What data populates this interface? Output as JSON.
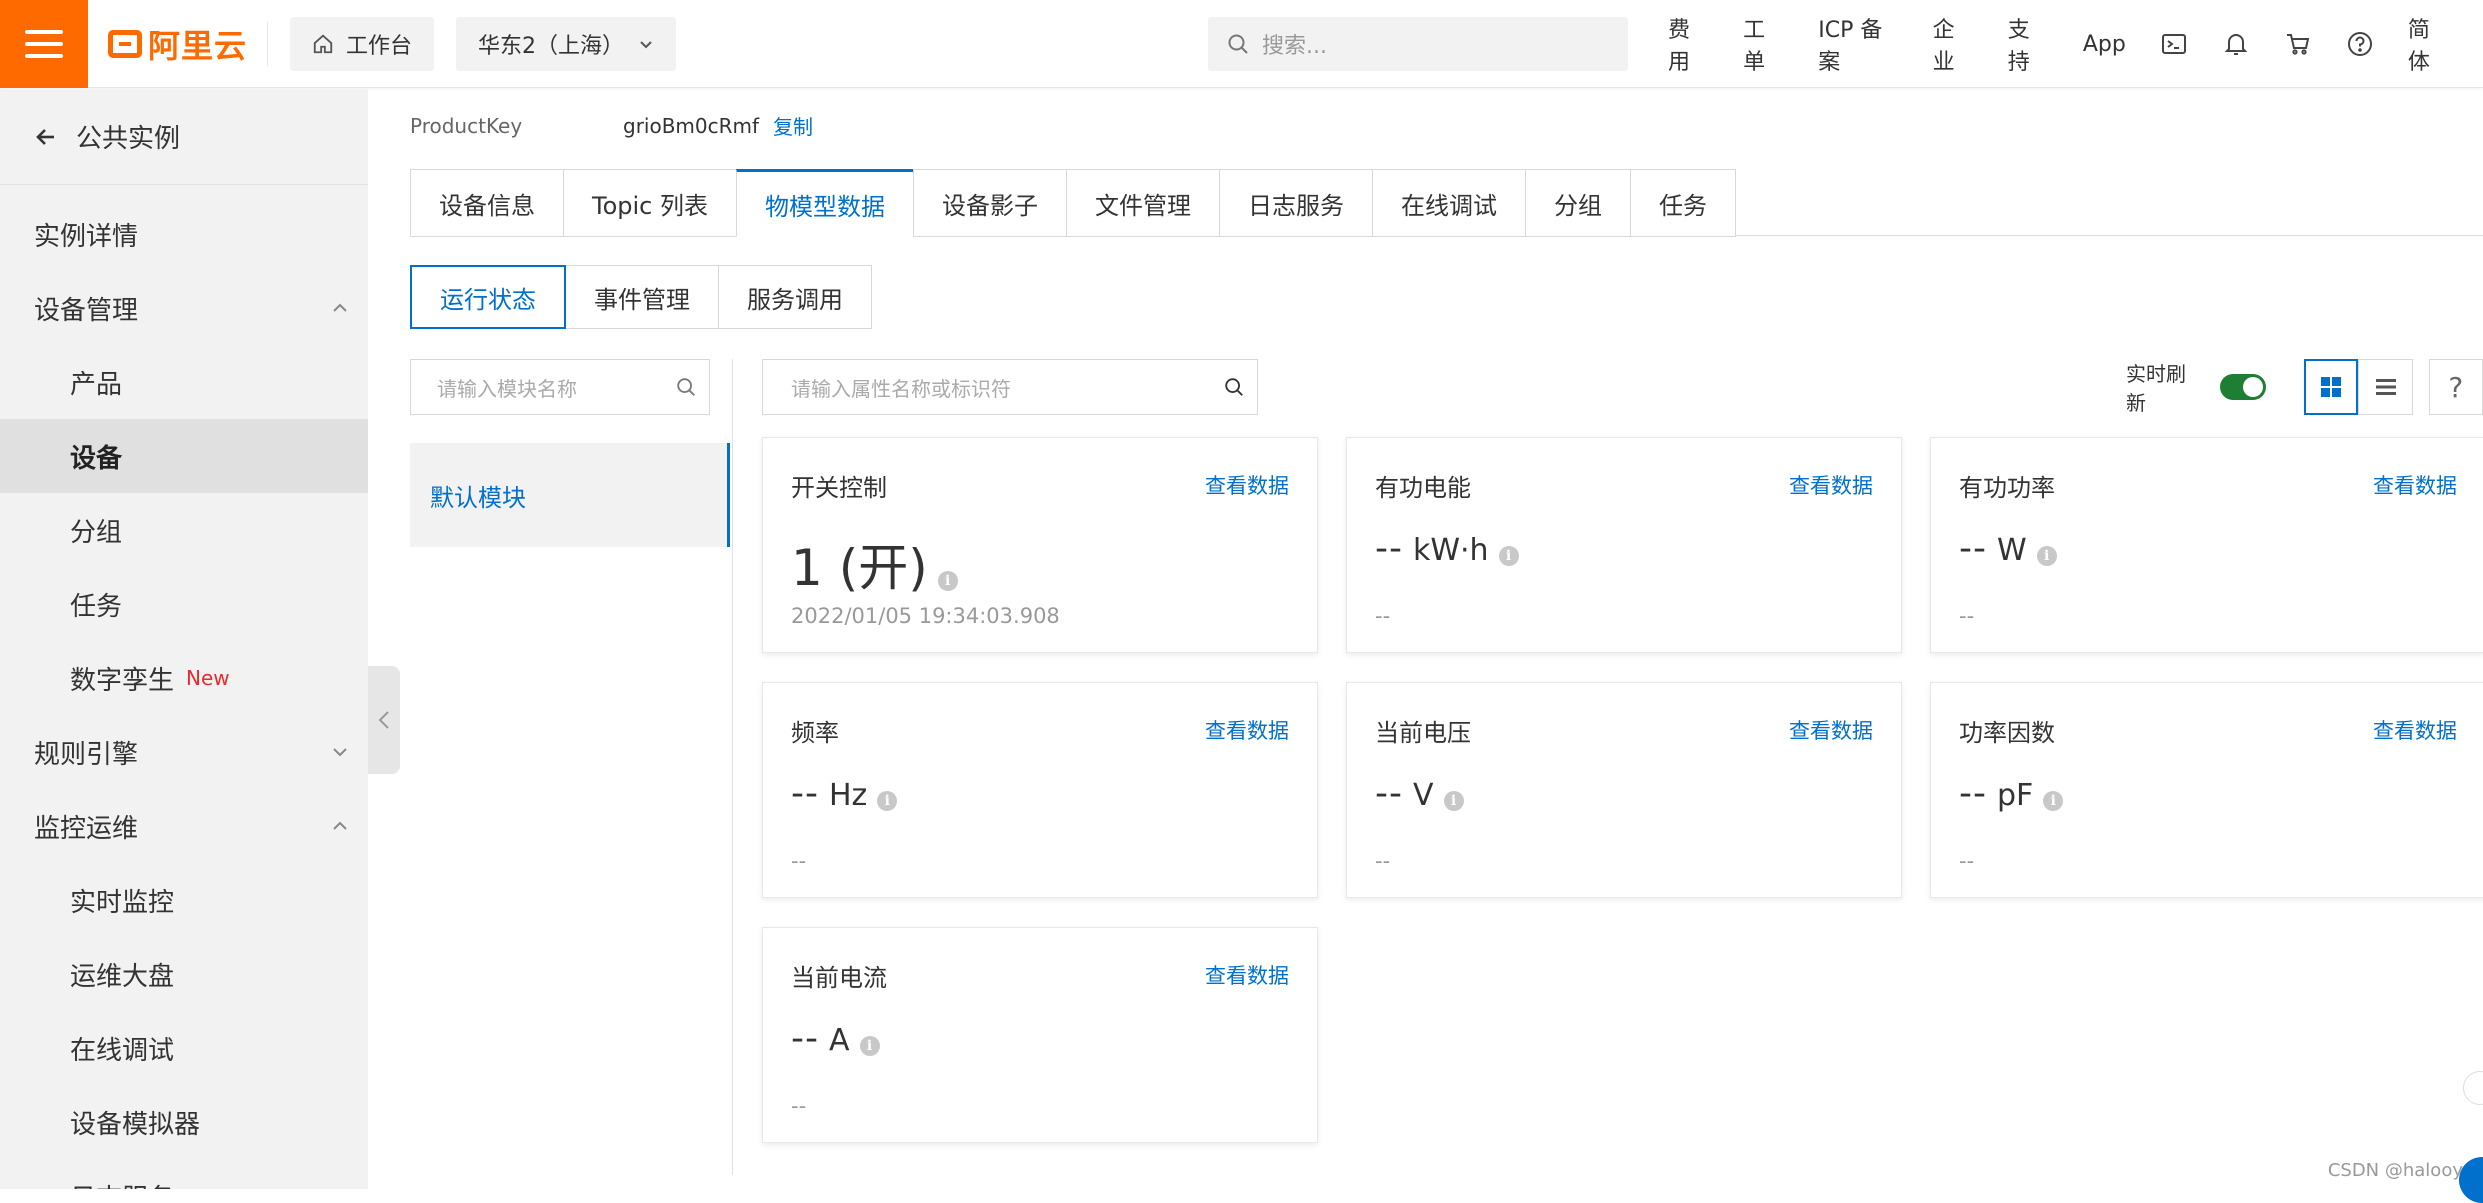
{
  "topbar": {
    "brand": "阿里云",
    "workbench": "工作台",
    "region": "华东2（上海）",
    "search_placeholder": "搜索...",
    "nav": [
      "费用",
      "工单",
      "ICP 备案",
      "企业",
      "支持",
      "App"
    ],
    "lang": "简体"
  },
  "sidebar": {
    "back_label": "公共实例",
    "items": [
      {
        "label": "实例详情"
      },
      {
        "label": "设备管理"
      },
      {
        "label": "产品"
      },
      {
        "label": "设备"
      },
      {
        "label": "分组"
      },
      {
        "label": "任务"
      },
      {
        "label": "数字孪生",
        "badge": "New"
      },
      {
        "label": "规则引擎"
      },
      {
        "label": "监控运维"
      },
      {
        "label": "实时监控"
      },
      {
        "label": "运维大盘"
      },
      {
        "label": "在线调试"
      },
      {
        "label": "设备模拟器"
      },
      {
        "label": "日志服务"
      }
    ]
  },
  "main": {
    "product_key_label": "ProductKey",
    "product_key_value": "grioBm0cRmf",
    "copy_label": "复制",
    "tabs": [
      "设备信息",
      "Topic 列表",
      "物模型数据",
      "设备影子",
      "文件管理",
      "日志服务",
      "在线调试",
      "分组",
      "任务"
    ],
    "subtabs": [
      "运行状态",
      "事件管理",
      "服务调用"
    ],
    "module_search_placeholder": "请输入模块名称",
    "default_module": "默认模块",
    "prop_search_placeholder": "请输入属性名称或标识符",
    "realtime_label": "实时刷新",
    "help": "?",
    "view_data": "查看数据",
    "cards": [
      {
        "title": "开关控制",
        "value": "1 (开)",
        "unit": "",
        "time": "2022/01/05 19:34:03.908"
      },
      {
        "title": "有功电能",
        "value": "--",
        "unit": "kW·h",
        "time": "--"
      },
      {
        "title": "有功功率",
        "value": "--",
        "unit": "W",
        "time": "--"
      },
      {
        "title": "频率",
        "value": "--",
        "unit": "Hz",
        "time": "--"
      },
      {
        "title": "当前电压",
        "value": "--",
        "unit": "V",
        "time": "--"
      },
      {
        "title": "功率因数",
        "value": "--",
        "unit": "pF",
        "time": "--"
      },
      {
        "title": "当前电流",
        "value": "--",
        "unit": "A",
        "time": "--"
      }
    ]
  },
  "watermark": "CSDN @halooy",
  "colors": {
    "accent": "#0070cc",
    "brand": "#ff6a00",
    "toggle_on": "#1e7e34",
    "badge_new": "#e62c2c"
  }
}
